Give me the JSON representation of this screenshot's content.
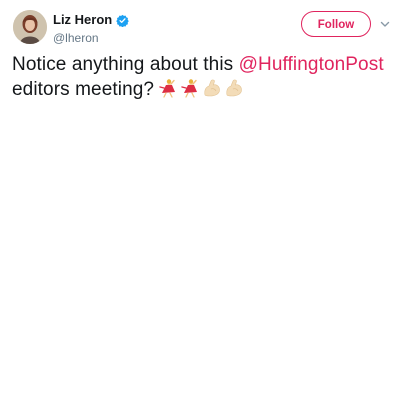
{
  "user": {
    "display_name": "Liz Heron",
    "handle": "@lheron",
    "verified": true
  },
  "actions": {
    "follow_label": "Follow"
  },
  "tweet": {
    "text_before": "Notice anything about this ",
    "mention": "@HuffingtonPost",
    "text_after": "editors meeting?",
    "emojis": [
      "dancer-emoji",
      "dancer-emoji",
      "flexed-biceps-emoji",
      "flexed-biceps-emoji"
    ]
  },
  "colors": {
    "accent": "#e0245e",
    "text": "#14171a",
    "muted": "#657786",
    "verified": "#1da1f2"
  }
}
